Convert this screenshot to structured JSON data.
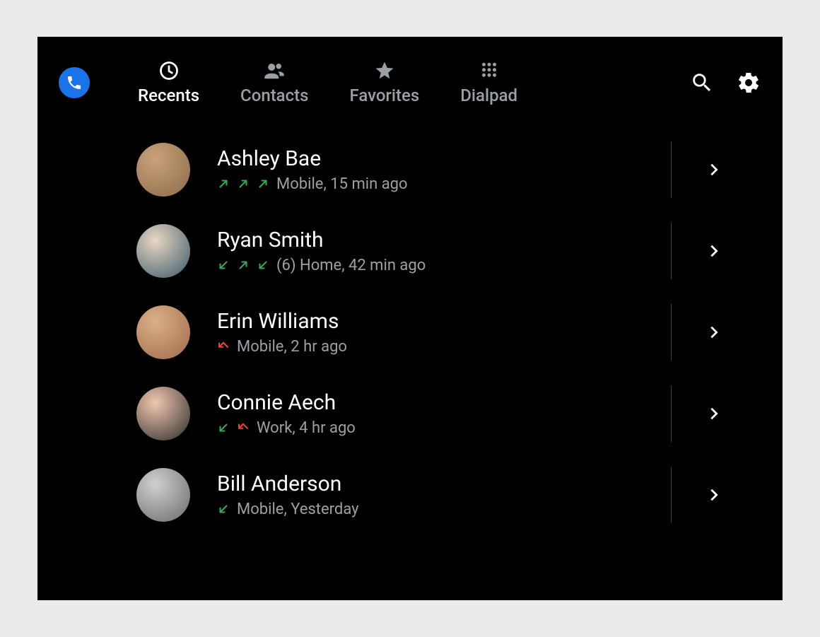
{
  "colors": {
    "accent": "#1a73e8",
    "call_made": "#34a853",
    "call_received": "#34a853",
    "call_missed": "#ea4335",
    "muted": "#9aa0a6",
    "divider": "#3c4043"
  },
  "tabs": [
    {
      "id": "recents",
      "label": "Recents",
      "icon": "clock-icon",
      "active": true
    },
    {
      "id": "contacts",
      "label": "Contacts",
      "icon": "people-icon",
      "active": false
    },
    {
      "id": "favorites",
      "label": "Favorites",
      "icon": "star-icon",
      "active": false
    },
    {
      "id": "dialpad",
      "label": "Dialpad",
      "icon": "dialpad-icon",
      "active": false
    }
  ],
  "calls": [
    {
      "name": "Ashley Bae",
      "call_types": [
        "outgoing",
        "outgoing",
        "outgoing"
      ],
      "count_prefix": "",
      "line": "Mobile",
      "time": "15 min ago",
      "avatar": {
        "bg1": "#c9a27b",
        "bg2": "#8b6a4a",
        "initials": ""
      }
    },
    {
      "name": "Ryan Smith",
      "call_types": [
        "incoming",
        "outgoing",
        "incoming"
      ],
      "count_prefix": "(6) ",
      "line": "Home",
      "time": "42 min ago",
      "avatar": {
        "bg1": "#e8d6c3",
        "bg2": "#3a5a6a",
        "initials": ""
      }
    },
    {
      "name": "Erin Williams",
      "call_types": [
        "missed"
      ],
      "count_prefix": "",
      "line": "Mobile",
      "time": "2 hr ago",
      "avatar": {
        "bg1": "#d9b089",
        "bg2": "#a06a4a",
        "initials": ""
      }
    },
    {
      "name": "Connie Aech",
      "call_types": [
        "incoming",
        "missed"
      ],
      "count_prefix": "",
      "line": "Work",
      "time": "4 hr ago",
      "avatar": {
        "bg1": "#f2c6b0",
        "bg2": "#2b2b2b",
        "initials": ""
      }
    },
    {
      "name": "Bill Anderson",
      "call_types": [
        "incoming"
      ],
      "count_prefix": "",
      "line": "Mobile",
      "time": "Yesterday",
      "avatar": {
        "bg1": "#d0d0d0",
        "bg2": "#6a6a6a",
        "initials": ""
      }
    }
  ]
}
